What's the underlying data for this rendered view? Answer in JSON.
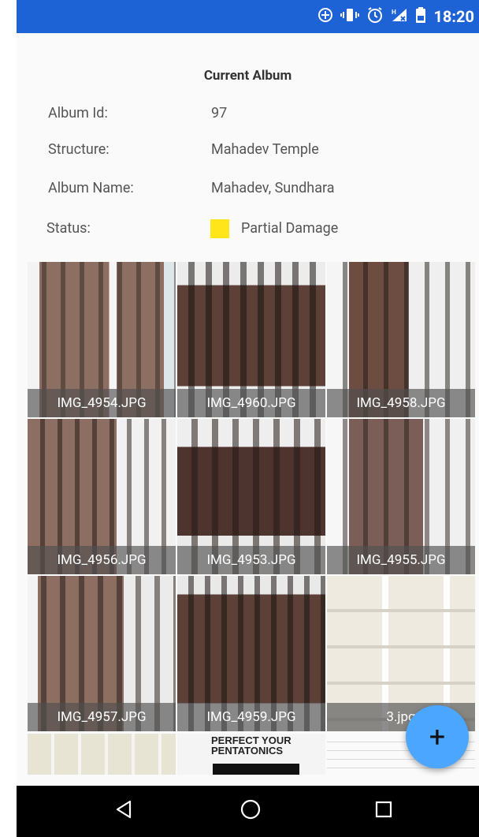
{
  "status_bar": {
    "time": "18:20",
    "icons": [
      "add-circle-icon",
      "vibrate-icon",
      "alarm-icon",
      "signal-no-data-icon",
      "battery-icon"
    ]
  },
  "album": {
    "title": "Current Album",
    "fields": [
      {
        "label": "Album Id:",
        "value": "97"
      },
      {
        "label": "Structure:",
        "value": "Mahadev Temple"
      },
      {
        "label": "Album Name:",
        "value": "Mahadev, Sundhara"
      }
    ],
    "status": {
      "label": "Status:",
      "value": "Partial Damage",
      "color": "#ffe51a"
    }
  },
  "photos": [
    {
      "caption": "IMG_4954.JPG"
    },
    {
      "caption": "IMG_4960.JPG"
    },
    {
      "caption": "IMG_4958.JPG"
    },
    {
      "caption": "IMG_4956.JPG"
    },
    {
      "caption": "IMG_4953.JPG"
    },
    {
      "caption": "IMG_4955.JPG"
    },
    {
      "caption": "IMG_4957.JPG"
    },
    {
      "caption": "IMG_4959.JPG"
    },
    {
      "caption": "3.jpg"
    }
  ],
  "partial_row": {
    "middle_text": "PERFECT YOUR PENTATONICS"
  },
  "fab": {
    "label": "+",
    "icon": "add-icon"
  },
  "nav_bar": {
    "back_icon": "back-triangle-icon",
    "home_icon": "home-circle-icon",
    "recents_icon": "recents-square-icon"
  },
  "colors": {
    "status_bar": "#1e63d6",
    "fab": "#4aa6ff",
    "status_swatch": "#ffe51a",
    "nav_bar": "#000000"
  }
}
